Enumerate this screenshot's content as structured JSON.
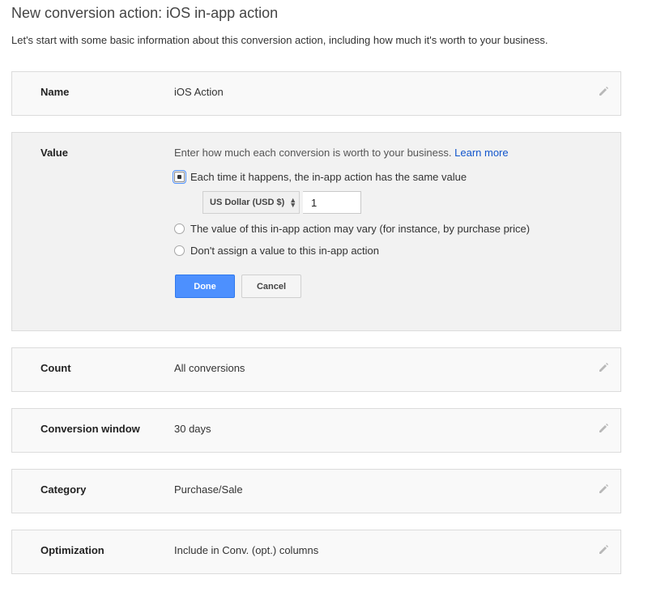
{
  "page": {
    "title": "New conversion action: iOS in-app action",
    "intro": "Let's start with some basic information about this conversion action, including how much it's worth to your business."
  },
  "name_panel": {
    "label": "Name",
    "value": "iOS Action",
    "edit_icon": "pencil-icon"
  },
  "value_panel": {
    "label": "Value",
    "hint": "Enter how much each conversion is worth to your business.",
    "learn_more": "Learn more",
    "options": [
      {
        "label": "Each time it happens, the in-app action has the same value",
        "selected": true
      },
      {
        "label": "The value of this in-app action may vary (for instance, by purchase price)",
        "selected": false
      },
      {
        "label": "Don't assign a value to this in-app action",
        "selected": false
      }
    ],
    "currency": "US Dollar (USD $)",
    "amount": "1",
    "done_label": "Done",
    "cancel_label": "Cancel"
  },
  "count_panel": {
    "label": "Count",
    "value": "All conversions"
  },
  "window_panel": {
    "label": "Conversion window",
    "value": "30 days"
  },
  "category_panel": {
    "label": "Category",
    "value": "Purchase/Sale"
  },
  "optimization_panel": {
    "label": "Optimization",
    "value": "Include in Conv. (opt.) columns"
  },
  "colors": {
    "accent": "#4d90fe",
    "link": "#1155cc",
    "panel_bg": "#f9f9f9",
    "border": "#dcdcdc"
  }
}
